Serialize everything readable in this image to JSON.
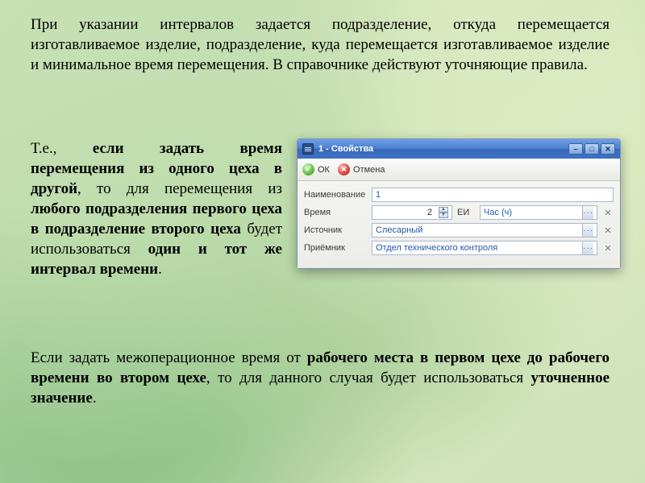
{
  "paragraphs": {
    "p1": "При указании интервалов задается подразделение, откуда перемещается изготавливаемое изделие, подразделение, куда перемещается изготавливаемое изделие и минимальное время перемещения. В справочнике действуют уточняющие правила.",
    "p2_parts": {
      "a": "Т.е., ",
      "b": "если задать время перемещения из одного цеха в другой",
      "c": ", то для перемещения из ",
      "d": "любого подразделения первого цеха в подразделение второго цеха",
      "e": " будет использоваться ",
      "f": "один и тот же интервал времени",
      "g": "."
    },
    "p3_parts": {
      "a": "Если задать межоперационное время от ",
      "b": "рабочего места в первом цехе до рабочего времени во втором цехе",
      "c": ", то для данного случая будет использоваться ",
      "d": "уточненное значение",
      "e": "."
    }
  },
  "dialog": {
    "title": "1 - Свойства",
    "ok": "ОК",
    "cancel": "Отмена",
    "labels": {
      "name": "Наименование",
      "time": "Время",
      "unit": "ЕИ",
      "source": "Источник",
      "receiver": "Приёмник"
    },
    "values": {
      "name": "1",
      "time": "2",
      "unit": "Час (ч)",
      "source": "Слесарный",
      "receiver": "Отдел технического контроля"
    }
  }
}
